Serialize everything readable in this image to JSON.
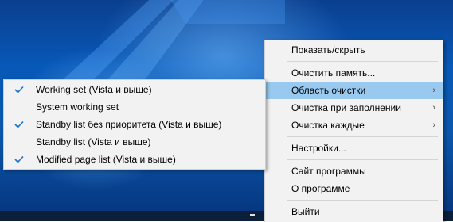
{
  "main_menu": {
    "items": [
      {
        "label": "Показать/скрыть"
      },
      {
        "label": "Очистить память..."
      },
      {
        "label": "Область очистки",
        "arrow": "›"
      },
      {
        "label": "Очистка при заполнении",
        "arrow": "›"
      },
      {
        "label": "Очистка каждые",
        "arrow": "›"
      },
      {
        "label": "Настройки..."
      },
      {
        "label": "Сайт программы"
      },
      {
        "label": "О программе"
      },
      {
        "label": "Выйти"
      }
    ]
  },
  "submenu": {
    "items": [
      {
        "label": "Working set (Vista и выше)",
        "checked": true
      },
      {
        "label": "System working set",
        "checked": false
      },
      {
        "label": "Standby list без приоритета (Vista и выше)",
        "checked": true
      },
      {
        "label": "Standby list (Vista и выше)",
        "checked": false
      },
      {
        "label": "Modified page list (Vista и выше)",
        "checked": true
      }
    ]
  },
  "icons": {
    "checkmark": "checkmark-icon",
    "submenu_arrow": "chevron-right-icon"
  },
  "colors": {
    "highlight": "#99c9ef",
    "menu_bg": "#f2f2f2",
    "check": "#1a73c8",
    "desktop": "#0758b8"
  }
}
